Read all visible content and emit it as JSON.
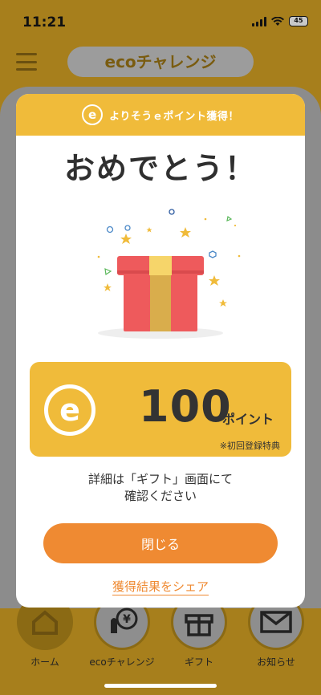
{
  "status_bar": {
    "time": "11:21",
    "battery": "45"
  },
  "header": {
    "title": "ecoチャレンジ"
  },
  "tabs": [
    {
      "label": "ホーム",
      "icon": "home-icon"
    },
    {
      "label": "ecoチャレンジ",
      "icon": "eco-challenge-icon"
    },
    {
      "label": "ギフト",
      "icon": "gift-icon"
    },
    {
      "label": "お知らせ",
      "icon": "mail-icon"
    }
  ],
  "modal": {
    "banner_badge": "e",
    "banner_text": "よりそうｅポイント獲得！",
    "title": "おめでとう！",
    "points": {
      "badge": "e",
      "value": "100",
      "unit": "ポイント",
      "note": "※初回登録特典"
    },
    "detail_line1": "詳細は「ギフト」画面にて",
    "detail_line2": "確認ください",
    "close_label": "閉じる",
    "share_label": "獲得結果をシェア"
  },
  "colors": {
    "accent_yellow": "#f0bb3a",
    "accent_orange": "#ef8a32",
    "gift_red": "#ee5a5c",
    "gift_ribbon": "#d9ad4c"
  }
}
